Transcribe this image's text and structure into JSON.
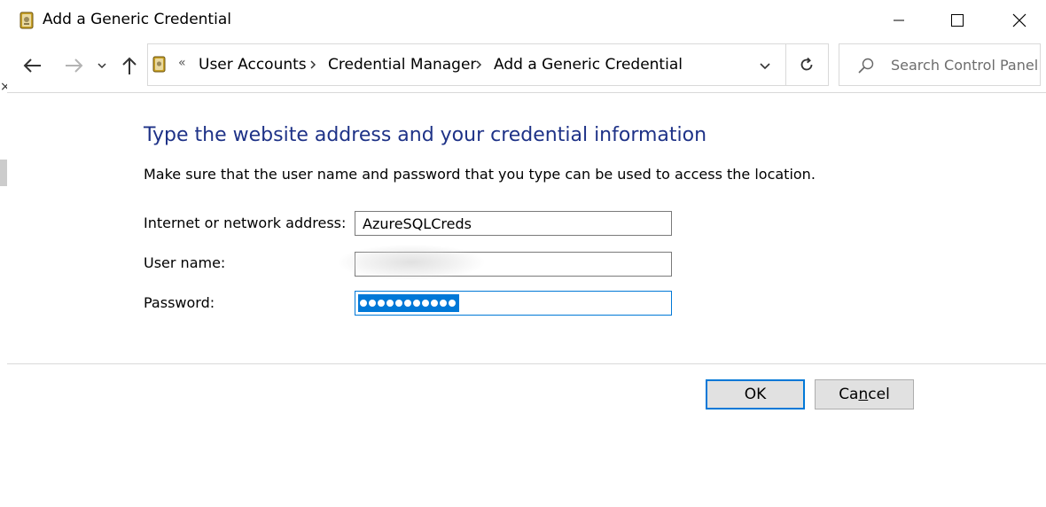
{
  "window": {
    "title": "Add a Generic Credential",
    "controls": {
      "minimize": "minimize",
      "maximize": "maximize",
      "close": "close"
    }
  },
  "address_bar": {
    "overflow_glyph": "«",
    "breadcrumbs": [
      "User Accounts",
      "Credential Manager",
      "Add a Generic Credential"
    ]
  },
  "search": {
    "placeholder": "Search Control Panel"
  },
  "form": {
    "heading": "Type the website address and your credential information",
    "description": "Make sure that the user name and password that you type can be used to access the location.",
    "address_label": "Internet or network address:",
    "address_value": "AzureSQLCreds",
    "username_label": "User name:",
    "username_value": "",
    "password_label": "Password:",
    "password_mask_count": 11
  },
  "buttons": {
    "ok": "OK",
    "cancel_prefix": "Ca",
    "cancel_accel": "n",
    "cancel_suffix": "cel"
  },
  "colors": {
    "heading": "#1e3287",
    "accent": "#0078d7",
    "button_face": "#e1e1e1"
  },
  "icons": [
    "credential-manager-icon",
    "back-arrow-icon",
    "forward-arrow-icon",
    "recent-locations-chevron-icon",
    "up-arrow-icon",
    "refresh-icon",
    "search-icon",
    "breadcrumb-separator-icon",
    "address-dropdown-icon"
  ]
}
